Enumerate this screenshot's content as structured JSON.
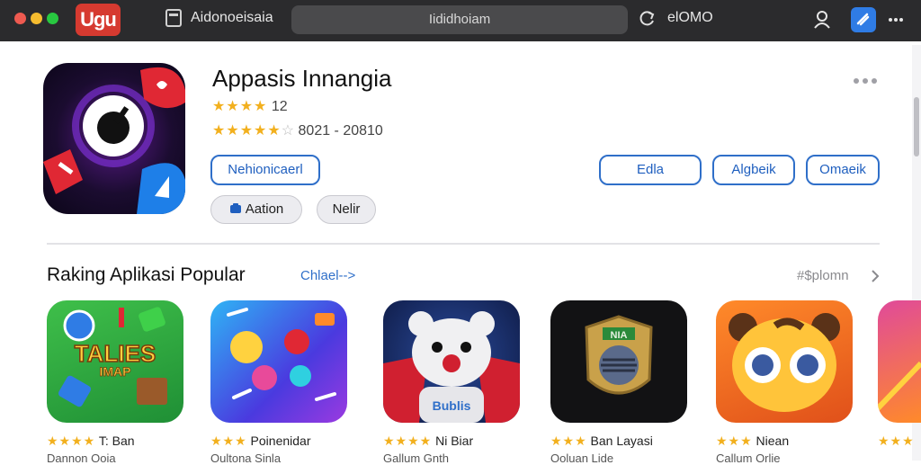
{
  "window": {
    "logo_text": "Ugu",
    "tab_title": "Aidonoeisaia",
    "address": "Iididhoiam",
    "right_text": "elOMO"
  },
  "app": {
    "title": "Appasis Innangia",
    "rating_stars": "★★★★",
    "rating_count": "12",
    "rating2_stars": "★★★★★",
    "rating2_half": "☆",
    "rating2_text": "8021 - 20810",
    "primary_button": "Nehionicaerl",
    "action_button": "Aation",
    "secondary_button": "Nelir",
    "right_buttons": [
      "Edla",
      "Algbeik",
      "Omaeik"
    ]
  },
  "section": {
    "title": "Raking Aplikasi Popular",
    "link": "Chlael-->",
    "right_label": "#$plomn"
  },
  "tiles": [
    {
      "stars": "★★★★",
      "label": "T: Ban",
      "sub": "Dannon Ooia",
      "art_text": "TALIES",
      "art_sub": "IMAP"
    },
    {
      "stars": "★★★",
      "label": "Poinenidar",
      "sub": "Oultona Sinla",
      "art_text": "",
      "art_sub": ""
    },
    {
      "stars": "★★★★",
      "label": "Ni Biar",
      "sub": "Gallum Gnth",
      "art_text": "Bublis",
      "art_sub": ""
    },
    {
      "stars": "★★★",
      "label": "Ban Layasi",
      "sub": "Ooluan Lide",
      "art_text": "NIA",
      "art_sub": ""
    },
    {
      "stars": "★★★",
      "label": "Niean",
      "sub": "Callum Orlie",
      "art_text": "",
      "art_sub": ""
    },
    {
      "stars": "★★★",
      "label": "",
      "sub": "",
      "art_text": "",
      "art_sub": ""
    }
  ],
  "colors": {
    "topbar": "#2b2b2d",
    "accent": "#2f6fc9",
    "star": "#f2b01e",
    "logo": "#d63a30"
  },
  "icons": [
    "document-icon",
    "reload-icon",
    "user-icon",
    "extension-icon",
    "more-icon",
    "chevron-right-icon",
    "more-dots-icon"
  ]
}
